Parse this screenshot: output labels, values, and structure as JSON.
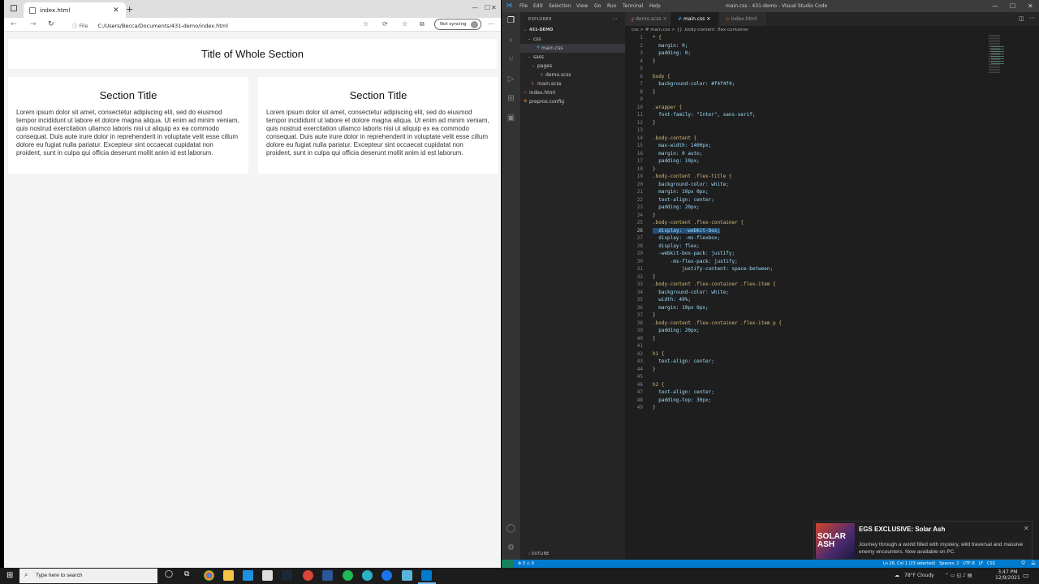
{
  "browser": {
    "tab_title": "index.html",
    "address_prefix": "File",
    "url": "C:/Users/Becca/Documents/431-demo/index.html",
    "sync_label": "Not syncing"
  },
  "page": {
    "main_title": "Title of Whole Section",
    "sections": [
      {
        "title": "Section Title",
        "text": "Lorem ipsum dolor sit amet, consectetur adipiscing elit, sed do eiusmod tempor incididunt ut labore et dolore magna aliqua. Ut enim ad minim veniam, quis nostrud exercitation ullamco laboris nisi ut aliquip ex ea commodo consequat. Duis aute irure dolor in reprehenderit in voluptate velit esse cillum dolore eu fugiat nulla pariatur. Excepteur sint occaecat cupidatat non proident, sunt in culpa qui officia deserunt mollit anim id est laborum."
      },
      {
        "title": "Section Title",
        "text": "Lorem ipsum dolor sit amet, consectetur adipiscing elit, sed do eiusmod tempor incididunt ut labore et dolore magna aliqua. Ut enim ad minim veniam, quis nostrud exercitation ullamco laboris nisi ut aliquip ex ea commodo consequat. Duis aute irure dolor in reprehenderit in voluptate velit esse cillum dolore eu fugiat nulla pariatur. Excepteur sint occaecat cupidatat non proident, sunt in culpa qui officia deserunt mollit anim id est laborum."
      }
    ]
  },
  "vscode": {
    "window_title": "main.css - 431-demo - Visual Studio Code",
    "menu": [
      "File",
      "Edit",
      "Selection",
      "View",
      "Go",
      "Run",
      "Terminal",
      "Help"
    ],
    "explorer_label": "EXPLORER",
    "project": "431-DEMO",
    "tree": [
      "css",
      "main.css",
      "sass",
      "pages",
      "demo.scss",
      "main.scss",
      "index.html",
      "prepros.config"
    ],
    "tabs": [
      "demo.scss",
      "main.css",
      "index.html"
    ],
    "breadcrumb": "css  >  # main.css  >  {} .body-content .flex-container",
    "outline_label": "OUTLINE",
    "status_left": "⊗ 0 ⚠ 0",
    "status_right": "Ln 26, Col 1 (23 selected)   Spaces: 2   UTF-8   LF   CSS",
    "code_lines": [
      "* {",
      "  margin: 0;",
      "  padding: 0;",
      "}",
      "",
      "body {",
      "  background-color: #f4f4f4;",
      "}",
      "",
      ".wrapper {",
      "  font-family: \"Inter\", sans-serif;",
      "}",
      "",
      ".body-content {",
      "  max-width: 1400px;",
      "  margin: 0 auto;",
      "  padding: 10px;",
      "}",
      ".body-content .flex-title {",
      "  background-color: white;",
      "  margin: 10px 0px;",
      "  text-align: center;",
      "  padding: 20px;",
      "}",
      ".body-content .flex-container {",
      "  display: -webkit-box;",
      "  display: -ms-flexbox;",
      "  display: flex;",
      "  -webkit-box-pack: justify;",
      "      -ms-flex-pack: justify;",
      "          justify-content: space-between;",
      "}",
      ".body-content .flex-container .flex-item {",
      "  background-color: white;",
      "  width: 49%;",
      "  margin: 10px 0px;",
      "}",
      ".body-content .flex-container .flex-item p {",
      "  padding: 20px;",
      "}",
      "",
      "h1 {",
      "  text-align: center;",
      "}",
      "",
      "h2 {",
      "  text-align: center;",
      "  padding-top: 30px;",
      "}"
    ],
    "line_numbers": [
      "1",
      "2",
      "3",
      "4",
      "5",
      "6",
      "7",
      "8",
      "9",
      "10",
      "11",
      "12",
      "13",
      "14",
      "15",
      "16",
      "17",
      "18",
      "19",
      "20",
      "21",
      "22",
      "23",
      "24",
      "25",
      "26",
      "27",
      "28",
      "29",
      "30",
      "31",
      "32",
      "33",
      "34",
      "35",
      "36",
      "37",
      "38",
      "39",
      "40",
      "41",
      "42",
      "43",
      "44",
      "45",
      "46",
      "47",
      "48",
      "49"
    ]
  },
  "notification": {
    "title": "EGS EXCLUSIVE: Solar Ash",
    "body": "Journey through a world filled with mystery, wild traversal and massive enemy encounters. Now available on PC.",
    "image_text": "SOLAR ASH"
  },
  "taskbar": {
    "search_placeholder": "Type here to search",
    "weather": "78°F  Cloudy",
    "time": "3:47 PM",
    "date": "12/9/2021"
  }
}
